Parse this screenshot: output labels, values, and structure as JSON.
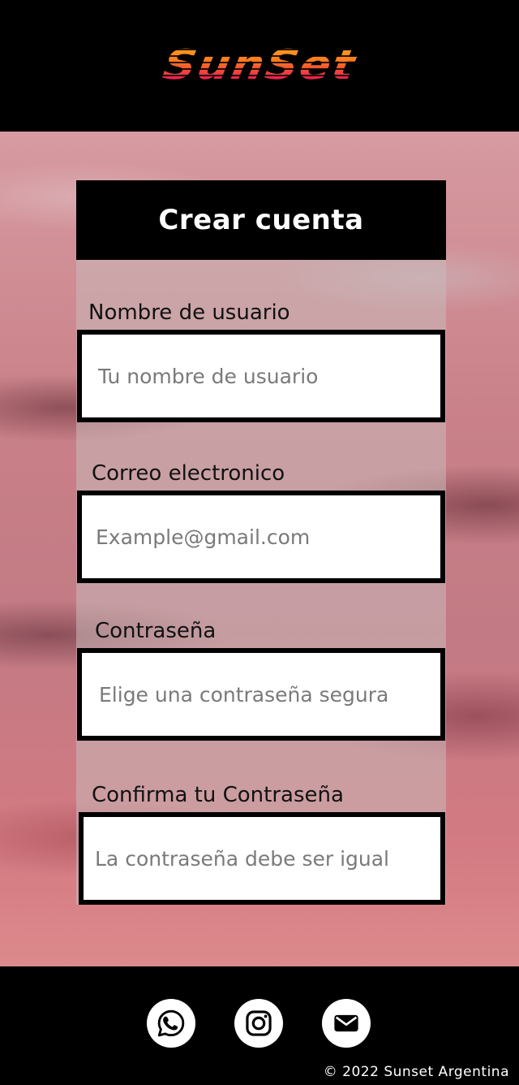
{
  "header": {
    "logo_text": "SunSet"
  },
  "form": {
    "title": "Crear cuenta",
    "fields": [
      {
        "label": "Nombre de usuario",
        "placeholder": "Tu nombre de usuario"
      },
      {
        "label": "Correo electronico",
        "placeholder": "Example@gmail.com"
      },
      {
        "label": "Contraseña",
        "placeholder": "Elige una contraseña segura"
      },
      {
        "label": "Confirma tu Contraseña",
        "placeholder": "La contraseña debe ser igual"
      }
    ]
  },
  "footer": {
    "social_icons": [
      "whatsapp-icon",
      "instagram-icon",
      "mail-icon"
    ],
    "copyright": "© 2022 Sunset Argentina"
  },
  "colors": {
    "header_bg": "#000000",
    "logo_top": "#ffb21e",
    "logo_bottom": "#e8214d",
    "sky": "#c98088"
  }
}
